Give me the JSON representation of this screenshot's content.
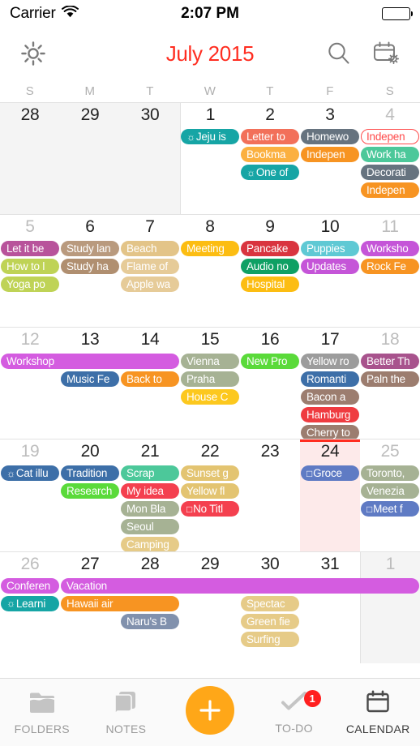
{
  "status_bar": {
    "carrier": "Carrier",
    "wifi_icon": "wifi-icon",
    "time": "2:07 PM",
    "battery_icon": "battery-full-icon"
  },
  "nav_bar": {
    "settings_icon": "gear-icon",
    "title": "July 2015",
    "search_icon": "search-icon",
    "calendar_settings_icon": "calendar-settings-icon",
    "title_color": "#ff2d20"
  },
  "weekdays": [
    "S",
    "M",
    "T",
    "W",
    "T",
    "F",
    "S"
  ],
  "calendar": {
    "today": 24,
    "today_highlight_color": "#fdeaea",
    "today_marker_color": "#ff2d20",
    "weeks": [
      {
        "days": [
          {
            "num": "28",
            "out": true
          },
          {
            "num": "29",
            "out": true
          },
          {
            "num": "30",
            "out": true
          },
          {
            "num": "1",
            "out": false
          },
          {
            "num": "2",
            "out": false
          },
          {
            "num": "3",
            "out": false
          },
          {
            "num": "4",
            "out": false,
            "dim": true
          }
        ],
        "events": [
          {
            "col": 3,
            "row": 0,
            "span": 1,
            "label": "Jeju is",
            "color": "#16a5a5",
            "prefix": "sun"
          },
          {
            "col": 4,
            "row": 0,
            "span": 1,
            "label": "Letter to",
            "color": "#f2705a"
          },
          {
            "col": 4,
            "row": 1,
            "span": 1,
            "label": "Bookma",
            "color": "#fbb040"
          },
          {
            "col": 4,
            "row": 2,
            "span": 1,
            "label": "One of",
            "color": "#16a5a5",
            "prefix": "sun"
          },
          {
            "col": 5,
            "row": 0,
            "span": 1,
            "label": "Homewo",
            "color": "#66737f"
          },
          {
            "col": 5,
            "row": 1,
            "span": 1,
            "label": "Indepen",
            "color": "#f79422"
          },
          {
            "col": 6,
            "row": 0,
            "span": 1,
            "label": "Indepen",
            "color": "#ffffff",
            "hollow": true
          },
          {
            "col": 6,
            "row": 1,
            "span": 1,
            "label": "Work ha",
            "color": "#4cc89a"
          },
          {
            "col": 6,
            "row": 2,
            "span": 1,
            "label": "Decorati",
            "color": "#66737f"
          },
          {
            "col": 6,
            "row": 3,
            "span": 1,
            "label": "Indepen",
            "color": "#f79422"
          }
        ]
      },
      {
        "days": [
          {
            "num": "5",
            "out": false,
            "dim": true
          },
          {
            "num": "6",
            "out": false
          },
          {
            "num": "7",
            "out": false
          },
          {
            "num": "8",
            "out": false
          },
          {
            "num": "9",
            "out": false
          },
          {
            "num": "10",
            "out": false
          },
          {
            "num": "11",
            "out": false,
            "dim": true
          }
        ],
        "events": [
          {
            "col": 0,
            "row": 0,
            "span": 1,
            "label": "Let it be",
            "color": "#b8539b"
          },
          {
            "col": 0,
            "row": 1,
            "span": 1,
            "label": "How to l",
            "color": "#bfd356"
          },
          {
            "col": 0,
            "row": 2,
            "span": 1,
            "label": "Yoga po",
            "color": "#bfd356"
          },
          {
            "col": 1,
            "row": 0,
            "span": 1,
            "label": "Study lan",
            "color": "#b99a7e"
          },
          {
            "col": 1,
            "row": 1,
            "span": 1,
            "label": "Study ha",
            "color": "#b08f70"
          },
          {
            "col": 2,
            "row": 0,
            "span": 1,
            "label": "Beach",
            "color": "#e3c488"
          },
          {
            "col": 2,
            "row": 1,
            "span": 1,
            "label": "Flame of",
            "color": "#e6cb98"
          },
          {
            "col": 2,
            "row": 2,
            "span": 1,
            "label": "Apple wa",
            "color": "#e6cb98"
          },
          {
            "col": 3,
            "row": 0,
            "span": 1,
            "label": "Meeting",
            "color": "#fcbd12"
          },
          {
            "col": 4,
            "row": 0,
            "span": 1,
            "label": "Pancake",
            "color": "#d9343f"
          },
          {
            "col": 4,
            "row": 1,
            "span": 1,
            "label": "Audio no",
            "color": "#0fa064"
          },
          {
            "col": 4,
            "row": 2,
            "span": 1,
            "label": "Hospital",
            "color": "#fcbd12"
          },
          {
            "col": 5,
            "row": 0,
            "span": 1,
            "label": "Puppies",
            "color": "#5fc9d4"
          },
          {
            "col": 5,
            "row": 1,
            "span": 1,
            "label": "Updates",
            "color": "#c555d8"
          },
          {
            "col": 6,
            "row": 0,
            "span": 1,
            "label": "Worksho",
            "color": "#c555d8"
          },
          {
            "col": 6,
            "row": 1,
            "span": 1,
            "label": "Rock Fe",
            "color": "#f79422"
          }
        ]
      },
      {
        "days": [
          {
            "num": "12",
            "out": false,
            "dim": true
          },
          {
            "num": "13",
            "out": false
          },
          {
            "num": "14",
            "out": false
          },
          {
            "num": "15",
            "out": false
          },
          {
            "num": "16",
            "out": false
          },
          {
            "num": "17",
            "out": false
          },
          {
            "num": "18",
            "out": false,
            "dim": true
          }
        ],
        "events": [
          {
            "col": 0,
            "row": 0,
            "span": 3,
            "label": "Workshop",
            "color": "#d45ce0"
          },
          {
            "col": 1,
            "row": 1,
            "span": 1,
            "label": "Music Fe",
            "color": "#3d6fa8"
          },
          {
            "col": 2,
            "row": 1,
            "span": 1,
            "label": "Back to",
            "color": "#f79422"
          },
          {
            "col": 3,
            "row": 0,
            "span": 1,
            "label": "Vienna",
            "color": "#a6b294"
          },
          {
            "col": 3,
            "row": 1,
            "span": 1,
            "label": "Praha",
            "color": "#a6b294"
          },
          {
            "col": 3,
            "row": 2,
            "span": 1,
            "label": "House C",
            "color": "#fcc81e"
          },
          {
            "col": 4,
            "row": 0,
            "span": 1,
            "label": "New Pro",
            "color": "#5ada3a"
          },
          {
            "col": 5,
            "row": 0,
            "span": 1,
            "label": "Yellow ro",
            "color": "#9c9c9c"
          },
          {
            "col": 5,
            "row": 1,
            "span": 1,
            "label": "Romanti",
            "color": "#3d6fa8"
          },
          {
            "col": 5,
            "row": 2,
            "span": 1,
            "label": "Bacon a",
            "color": "#9c7d6f"
          },
          {
            "col": 5,
            "row": 3,
            "span": 1,
            "label": "Hamburg",
            "color": "#ef3b40"
          },
          {
            "col": 5,
            "row": 4,
            "span": 1,
            "label": "Cherry to",
            "color": "#9c7d6f"
          },
          {
            "col": 6,
            "row": 0,
            "span": 1,
            "label": "Better Th",
            "color": "#a8538d"
          },
          {
            "col": 6,
            "row": 1,
            "span": 1,
            "label": "Paln the",
            "color": "#9c7d6f"
          }
        ]
      },
      {
        "days": [
          {
            "num": "19",
            "out": false,
            "dim": true
          },
          {
            "num": "20",
            "out": false
          },
          {
            "num": "21",
            "out": false
          },
          {
            "num": "22",
            "out": false
          },
          {
            "num": "23",
            "out": false
          },
          {
            "num": "24",
            "out": false,
            "today": true
          },
          {
            "num": "25",
            "out": false,
            "dim": true
          }
        ],
        "events": [
          {
            "col": 0,
            "row": 0,
            "span": 1,
            "label": "Cat illu",
            "color": "#3d6fa8",
            "prefix": "sun"
          },
          {
            "col": 1,
            "row": 0,
            "span": 1,
            "label": "Tradition",
            "color": "#3d6fa8"
          },
          {
            "col": 1,
            "row": 1,
            "span": 1,
            "label": "Research",
            "color": "#5ada3a"
          },
          {
            "col": 2,
            "row": 0,
            "span": 1,
            "label": "Scrap",
            "color": "#4cc89a"
          },
          {
            "col": 2,
            "row": 1,
            "span": 1,
            "label": "My idea",
            "color": "#f4404f"
          },
          {
            "col": 2,
            "row": 2,
            "span": 1,
            "label": "Mon Bla",
            "color": "#a6b294"
          },
          {
            "col": 2,
            "row": 3,
            "span": 1,
            "label": "Seoul",
            "color": "#a6b294"
          },
          {
            "col": 2,
            "row": 4,
            "span": 1,
            "label": "Camping",
            "color": "#e6cb88"
          },
          {
            "col": 3,
            "row": 0,
            "span": 1,
            "label": "Sunset g",
            "color": "#e3c471"
          },
          {
            "col": 3,
            "row": 1,
            "span": 1,
            "label": "Yellow fl",
            "color": "#e3c471"
          },
          {
            "col": 3,
            "row": 2,
            "span": 1,
            "label": "No Titl",
            "color": "#f4404f",
            "prefix": "check"
          },
          {
            "col": 5,
            "row": 0,
            "span": 1,
            "label": "Groce",
            "color": "#5f7bc4",
            "prefix": "check"
          },
          {
            "col": 6,
            "row": 0,
            "span": 1,
            "label": "Toronto,",
            "color": "#a6b294"
          },
          {
            "col": 6,
            "row": 1,
            "span": 1,
            "label": "Venezia",
            "color": "#a6b294"
          },
          {
            "col": 6,
            "row": 2,
            "span": 1,
            "label": "Meet f",
            "color": "#5f7bc4",
            "prefix": "check"
          }
        ]
      },
      {
        "days": [
          {
            "num": "26",
            "out": false,
            "dim": true
          },
          {
            "num": "27",
            "out": false
          },
          {
            "num": "28",
            "out": false
          },
          {
            "num": "29",
            "out": false
          },
          {
            "num": "30",
            "out": false
          },
          {
            "num": "31",
            "out": false
          },
          {
            "num": "1",
            "out": true,
            "dim": true
          }
        ],
        "events": [
          {
            "col": 0,
            "row": 0,
            "span": 1,
            "label": "Conferen",
            "color": "#d45ce0"
          },
          {
            "col": 0,
            "row": 1,
            "span": 1,
            "label": "Learni",
            "color": "#16a5a5",
            "prefix": "sun"
          },
          {
            "col": 1,
            "row": 0,
            "span": 6,
            "label": "Vacation",
            "color": "#d45ce0"
          },
          {
            "col": 1,
            "row": 1,
            "span": 2,
            "label": "Hawaii air",
            "color": "#f79422"
          },
          {
            "col": 2,
            "row": 2,
            "span": 1,
            "label": "Naru's B",
            "color": "#8191ad"
          },
          {
            "col": 4,
            "row": 1,
            "span": 1,
            "label": "Spectac",
            "color": "#e6cb88"
          },
          {
            "col": 4,
            "row": 2,
            "span": 1,
            "label": "Green fie",
            "color": "#e6cb88"
          },
          {
            "col": 4,
            "row": 3,
            "span": 1,
            "label": "Surfing",
            "color": "#e6cb88"
          }
        ]
      }
    ]
  },
  "tab_bar": {
    "items": [
      {
        "label": "FOLDERS",
        "icon": "folder-icon",
        "active": false
      },
      {
        "label": "NOTES",
        "icon": "notes-icon",
        "active": false
      },
      {
        "label": "",
        "icon": "add-icon",
        "active": false,
        "fab": true
      },
      {
        "label": "TO-DO",
        "icon": "check-icon",
        "active": false,
        "badge": "1"
      },
      {
        "label": "CALENDAR",
        "icon": "calendar-icon",
        "active": true
      }
    ],
    "fab_color": "#ffa718",
    "badge_color": "#ff1f1f"
  }
}
